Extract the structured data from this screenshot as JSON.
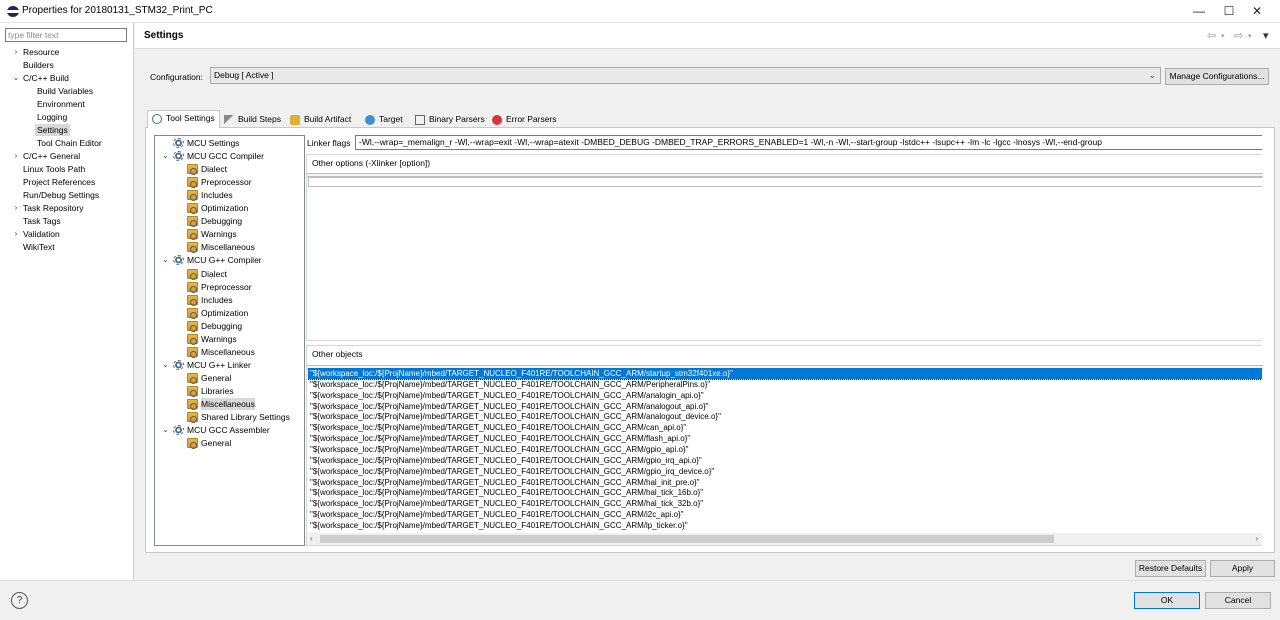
{
  "window": {
    "title": "Properties for 20180131_STM32_Print_PC",
    "minimize": "—",
    "maximize": "☐",
    "close": "✕"
  },
  "filter": {
    "placeholder": "type filter text"
  },
  "nav": [
    {
      "label": "Resource",
      "twisty": "›"
    },
    {
      "label": "Builders",
      "twisty": ""
    },
    {
      "label": "C/C++ Build",
      "twisty": "⌄"
    },
    {
      "label": "Build Variables",
      "twisty": ""
    },
    {
      "label": "Environment",
      "twisty": ""
    },
    {
      "label": "Logging",
      "twisty": ""
    },
    {
      "label": "Settings",
      "twisty": ""
    },
    {
      "label": "Tool Chain Editor",
      "twisty": ""
    },
    {
      "label": "C/C++ General",
      "twisty": "›"
    },
    {
      "label": "Linux Tools Path",
      "twisty": ""
    },
    {
      "label": "Project References",
      "twisty": ""
    },
    {
      "label": "Run/Debug Settings",
      "twisty": ""
    },
    {
      "label": "Task Repository",
      "twisty": "›"
    },
    {
      "label": "Task Tags",
      "twisty": ""
    },
    {
      "label": "Validation",
      "twisty": "›"
    },
    {
      "label": "WikiText",
      "twisty": ""
    }
  ],
  "header": {
    "title": "Settings",
    "back": "⇦",
    "fwd": "⇨",
    "menu": "▾"
  },
  "config": {
    "label": "Configuration:",
    "value": "Debug  [ Active ]",
    "manage_label": "Manage Configurations..."
  },
  "tabs": [
    {
      "label": "Tool Settings"
    },
    {
      "label": "Build Steps"
    },
    {
      "label": "Build Artifact"
    },
    {
      "label": "Target"
    },
    {
      "label": "Binary Parsers"
    },
    {
      "label": "Error Parsers"
    }
  ],
  "tree": [
    {
      "label": "MCU Settings",
      "twisty": ""
    },
    {
      "label": "MCU GCC Compiler",
      "twisty": "⌄"
    },
    {
      "label": "Dialect",
      "twisty": ""
    },
    {
      "label": "Preprocessor",
      "twisty": ""
    },
    {
      "label": "Includes",
      "twisty": ""
    },
    {
      "label": "Optimization",
      "twisty": ""
    },
    {
      "label": "Debugging",
      "twisty": ""
    },
    {
      "label": "Warnings",
      "twisty": ""
    },
    {
      "label": "Miscellaneous",
      "twisty": ""
    },
    {
      "label": "MCU G++ Compiler",
      "twisty": "⌄"
    },
    {
      "label": "Dialect",
      "twisty": ""
    },
    {
      "label": "Preprocessor",
      "twisty": ""
    },
    {
      "label": "Includes",
      "twisty": ""
    },
    {
      "label": "Optimization",
      "twisty": ""
    },
    {
      "label": "Debugging",
      "twisty": ""
    },
    {
      "label": "Warnings",
      "twisty": ""
    },
    {
      "label": "Miscellaneous",
      "twisty": ""
    },
    {
      "label": "MCU G++ Linker",
      "twisty": "⌄"
    },
    {
      "label": "General",
      "twisty": ""
    },
    {
      "label": "Libraries",
      "twisty": ""
    },
    {
      "label": "Miscellaneous",
      "twisty": ""
    },
    {
      "label": "Shared Library Settings",
      "twisty": ""
    },
    {
      "label": "MCU GCC Assembler",
      "twisty": "⌄"
    },
    {
      "label": "General",
      "twisty": ""
    }
  ],
  "linker": {
    "flags_label": "Linker flags",
    "flags_value": "-Wl,--wrap=_memalign_r -Wl,--wrap=exit -Wl,--wrap=atexit -DMBED_DEBUG -DMBED_TRAP_ERRORS_ENABLED=1 -Wl,-n -Wl,--start-group -lstdc++ -lsupc++ -lm -lc -lgcc -lnosys -Wl,--end-group",
    "other_options_title": "Other options (-Xlinker [option])",
    "other_objects_title": "Other objects",
    "objects": [
      "\"${workspace_loc:/${ProjName}/mbed/TARGET_NUCLEO_F401RE/TOOLCHAIN_GCC_ARM/startup_stm32f401xe.o}\"",
      "\"${workspace_loc:/${ProjName}/mbed/TARGET_NUCLEO_F401RE/TOOLCHAIN_GCC_ARM/PeripheralPins.o}\"",
      "\"${workspace_loc:/${ProjName}/mbed/TARGET_NUCLEO_F401RE/TOOLCHAIN_GCC_ARM/analogin_api.o}\"",
      "\"${workspace_loc:/${ProjName}/mbed/TARGET_NUCLEO_F401RE/TOOLCHAIN_GCC_ARM/analogout_api.o}\"",
      "\"${workspace_loc:/${ProjName}/mbed/TARGET_NUCLEO_F401RE/TOOLCHAIN_GCC_ARM/analogout_device.o}\"",
      "\"${workspace_loc:/${ProjName}/mbed/TARGET_NUCLEO_F401RE/TOOLCHAIN_GCC_ARM/can_api.o}\"",
      "\"${workspace_loc:/${ProjName}/mbed/TARGET_NUCLEO_F401RE/TOOLCHAIN_GCC_ARM/flash_api.o}\"",
      "\"${workspace_loc:/${ProjName}/mbed/TARGET_NUCLEO_F401RE/TOOLCHAIN_GCC_ARM/gpio_api.o}\"",
      "\"${workspace_loc:/${ProjName}/mbed/TARGET_NUCLEO_F401RE/TOOLCHAIN_GCC_ARM/gpio_irq_api.o}\"",
      "\"${workspace_loc:/${ProjName}/mbed/TARGET_NUCLEO_F401RE/TOOLCHAIN_GCC_ARM/gpio_irq_device.o}\"",
      "\"${workspace_loc:/${ProjName}/mbed/TARGET_NUCLEO_F401RE/TOOLCHAIN_GCC_ARM/hal_init_pre.o}\"",
      "\"${workspace_loc:/${ProjName}/mbed/TARGET_NUCLEO_F401RE/TOOLCHAIN_GCC_ARM/hal_tick_16b.o}\"",
      "\"${workspace_loc:/${ProjName}/mbed/TARGET_NUCLEO_F401RE/TOOLCHAIN_GCC_ARM/hal_tick_32b.o}\"",
      "\"${workspace_loc:/${ProjName}/mbed/TARGET_NUCLEO_F401RE/TOOLCHAIN_GCC_ARM/i2c_api.o}\"",
      "\"${workspace_loc:/${ProjName}/mbed/TARGET_NUCLEO_F401RE/TOOLCHAIN_GCC_ARM/lp_ticker.o}\""
    ]
  },
  "scroll": {
    "left": "‹",
    "right": "›"
  },
  "buttons": {
    "restore_defaults": "Restore Defaults",
    "apply": "Apply",
    "ok": "OK",
    "cancel": "Cancel"
  },
  "help": {
    "glyph": "?"
  },
  "colors": {
    "selection": "#0078d7",
    "tree_selection": "#d9d9d9"
  }
}
